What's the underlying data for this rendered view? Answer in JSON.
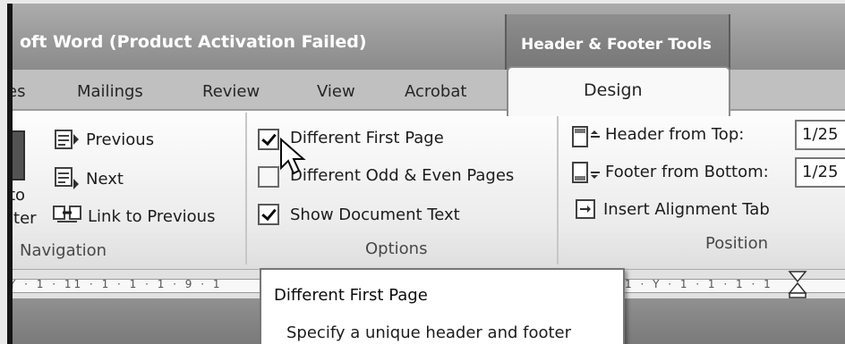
{
  "window": {
    "title": "oft Word (Product Activation Failed)"
  },
  "contextual_tab": {
    "label": "Header & Footer Tools"
  },
  "tabs": [
    "es",
    "Mailings",
    "Review",
    "View",
    "Acrobat",
    "Design"
  ],
  "ribbon": {
    "navigation": {
      "partial_button_lines": [
        "to",
        "oter"
      ],
      "items": [
        "Previous",
        "Next",
        "Link to Previous"
      ],
      "group_label": "Navigation"
    },
    "options": {
      "items": [
        {
          "label": "Different First Page",
          "checked": true
        },
        {
          "label": "Different Odd & Even Pages",
          "checked": false
        },
        {
          "label": "Show Document Text",
          "checked": true
        }
      ],
      "group_label": "Options"
    },
    "position": {
      "header_from_top": {
        "label": "Header from Top:",
        "value": "1/25"
      },
      "footer_from_bottom": {
        "label": "Footer from Bottom:",
        "value": "1/25"
      },
      "insert_alignment_tab": "Insert Alignment Tab",
      "group_label": "Position"
    }
  },
  "ruler": {
    "left_numbers": "Y · 1 · 11 · 1 · 1 · 1 · 9 · 1",
    "right_numbers": "1 · Y · 1 · 1 · 1 · 1"
  },
  "tooltip": {
    "title": "Different First Page",
    "description": "Specify a unique header and footer"
  }
}
